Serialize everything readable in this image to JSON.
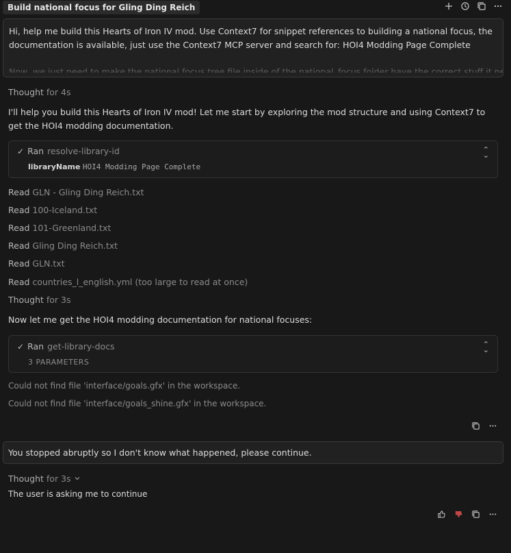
{
  "header": {
    "title": "Build national focus for Gling Ding Reich",
    "icons": [
      "plus-icon",
      "history-icon",
      "copy-icon",
      "more-icon"
    ]
  },
  "user_message_1": {
    "text": "Hi, help me build this Hearts of Iron IV mod. Use Context7 for snippet references to building a national focus, the documentation is available, just use the Context7 MCP server and search for: HOI4 Modding Page Complete",
    "faded_text": "Now, we just need to make the national focus tree file inside of the national_focus folder have the correct stuff it needs in"
  },
  "thought_1": {
    "label": "Thought",
    "duration": "for 4s"
  },
  "assistant_1": "I'll help you build this Hearts of Iron IV mod! Let me start by exploring the mod structure and using Context7 to get the HOI4 modding documentation.",
  "tool_1": {
    "status": "Ran",
    "name": "resolve-library-id",
    "param_key": "libraryName",
    "param_value": "HOI4 Modding Page Complete"
  },
  "reads": [
    {
      "label": "Read",
      "file": "GLN - Gling Ding Reich.txt"
    },
    {
      "label": "Read",
      "file": "100-Iceland.txt"
    },
    {
      "label": "Read",
      "file": "101-Greenland.txt"
    },
    {
      "label": "Read",
      "file": "Gling Ding Reich.txt"
    },
    {
      "label": "Read",
      "file": "GLN.txt"
    },
    {
      "label": "Read",
      "file": "countries_l_english.yml (too large to read at once)"
    }
  ],
  "thought_2": {
    "label": "Thought",
    "duration": "for 3s"
  },
  "assistant_2": "Now let me get the HOI4 modding documentation for national focuses:",
  "tool_2": {
    "status": "Ran",
    "name": "get-library-docs",
    "params": "3 PARAMETERS"
  },
  "errors": [
    "Could not find file 'interface/goals.gfx' in the workspace.",
    "Could not find file 'interface/goals_shine.gfx' in the workspace."
  ],
  "user_message_2": {
    "text": "You stopped abruptly so I don't know what happened, please continue."
  },
  "thought_3": {
    "label": "Thought",
    "duration": "for 3s"
  },
  "assistant_3": "The user is asking me to continue",
  "colors": {
    "background": "#181818",
    "dislike_active": "#c04848"
  }
}
